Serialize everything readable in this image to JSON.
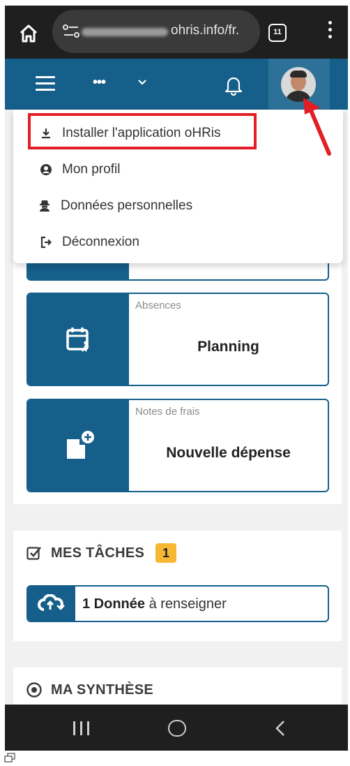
{
  "browser": {
    "url_visible": "ohris.info/fr.",
    "tab_count": "11"
  },
  "menu": {
    "items": [
      {
        "label": "Installer l'application oHRis",
        "icon": "download-icon"
      },
      {
        "label": "Mon profil",
        "icon": "user-circle-icon"
      },
      {
        "label": "Données personnelles",
        "icon": "user-secret-icon"
      },
      {
        "label": "Déconnexion",
        "icon": "logout-icon"
      }
    ]
  },
  "tiles": [
    {
      "category": "Absences",
      "title": "Planning",
      "icon": "calendar-person-icon"
    },
    {
      "category": "Notes de frais",
      "title": "Nouvelle dépense",
      "icon": "file-plus-icon"
    }
  ],
  "tasks": {
    "heading": "MES TÂCHES",
    "count": "1",
    "item_bold": "1 Donnée",
    "item_rest": " à renseigner"
  },
  "synthese": {
    "heading": "MA SYNTHÈSE"
  },
  "colors": {
    "brand_blue": "#155f8a",
    "highlight_red": "#e31e24",
    "badge_yellow": "#f7b733"
  }
}
